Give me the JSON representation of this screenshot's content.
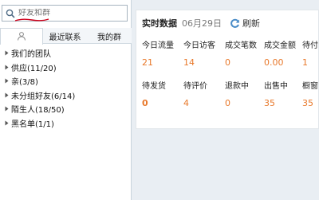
{
  "search": {
    "placeholder": "好友和群"
  },
  "tabs": [
    {
      "label": ""
    },
    {
      "label": "最近联系"
    },
    {
      "label": "我的群"
    }
  ],
  "groups": [
    {
      "label": "我们的团队"
    },
    {
      "label": "供应(11/20)"
    },
    {
      "label": "亲(3/8)"
    },
    {
      "label": "未分组好友(6/14)"
    },
    {
      "label": "陌生人(18/50)"
    },
    {
      "label": "黑名单(1/1)"
    }
  ],
  "realtime": {
    "title": "实时数据",
    "date": "06月29日",
    "refresh_label": "刷新",
    "row1": [
      {
        "label": "今日流量",
        "value": "21"
      },
      {
        "label": "今日访客",
        "value": "14"
      },
      {
        "label": "成交笔数",
        "value": "0"
      },
      {
        "label": "成交金额",
        "value": "0.00"
      },
      {
        "label": "待付",
        "value": "1"
      }
    ],
    "row2": [
      {
        "label": "待发货",
        "value": "0"
      },
      {
        "label": "待评价",
        "value": "4"
      },
      {
        "label": "退款中",
        "value": "0"
      },
      {
        "label": "出售中",
        "value": "35"
      },
      {
        "label": "橱窗",
        "value": "35"
      }
    ]
  },
  "colors": {
    "accent": "#e8782a",
    "underline": "#d0021b",
    "refresh_icon": "#4a8cc7"
  }
}
